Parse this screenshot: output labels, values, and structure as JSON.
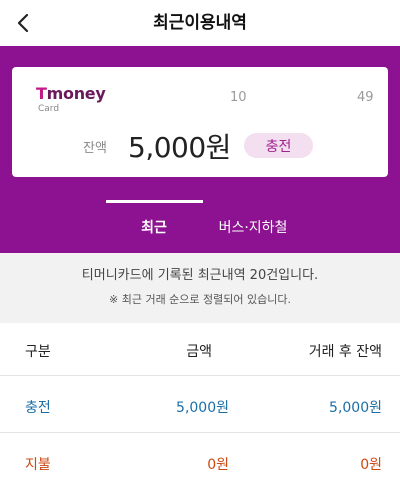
{
  "header": {
    "title": "최근이용내역",
    "back_icon": "chevron-left-icon"
  },
  "card": {
    "logo_main": "money",
    "logo_t": "T",
    "logo_sub": "Card",
    "number_part1": "10",
    "number_part2": "49",
    "balance_label": "잔액",
    "balance_amount": "5,000원",
    "charge_label": "충전"
  },
  "tabs": [
    {
      "label": "최근",
      "selected": true
    },
    {
      "label": "버스·지하철",
      "selected": false
    }
  ],
  "notice": {
    "main": "티머니카드에 기록된 최근내역 20건입니다.",
    "sub": "※ 최근 거래 순으로 정렬되어 있습니다."
  },
  "table": {
    "columns": [
      "구분",
      "금액",
      "거래 후 잔액"
    ],
    "rows": [
      {
        "type": "충전",
        "amount": "5,000원",
        "balance": "5,000원"
      },
      {
        "type": "지불",
        "amount": "0원",
        "balance": "0원"
      }
    ]
  },
  "colors": {
    "brand_purple": "#8c1291",
    "charge_blue": "#1b6fa8",
    "pay_orange": "#cc4a12"
  }
}
